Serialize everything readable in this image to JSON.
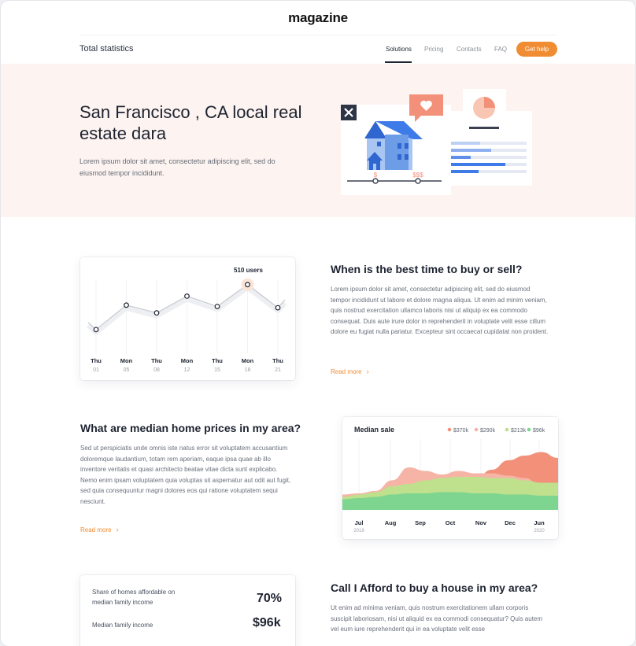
{
  "brand": "magazine",
  "nav": {
    "title": "Total statistics",
    "links": [
      "Solutions",
      "Pricing",
      "Contacts",
      "FAQ"
    ],
    "active": "Solutions",
    "cta": "Get help"
  },
  "hero": {
    "title": "San Francisco , CA local real estate dara",
    "subtitle": "Lorem ipsum dolor sit amet, consectetur adipiscing elit, sed do eiusmod tempor incididunt.",
    "illustration": {
      "price_low": "$",
      "price_high": "$$$"
    }
  },
  "section1": {
    "title": "When is the best time to buy or sell?",
    "body": "Lorem ipsum dolor sit amet, consectetur adipiscing elit, sed do eiusmod tempor incididunt ut labore et dolore magna aliqua. Ut enim ad minim veniam, quis nostrud exercitation ullamco laboris nisi ut aliquip ex ea commodo consequat. Duis aute irure dolor in reprehenderit in voluptate velit esse cillum dolore eu fugiat nulla pariatur. Excepteur sint occaecat cupidatat non proident.",
    "read_more": "Read more"
  },
  "section2": {
    "title": "What are median home prices in my area?",
    "body": "Sed ut perspiciatis unde omnis iste natus error sit voluptatem accusantium doloremque laudantium, totam rem aperiam, eaque ipsa quae ab illo inventore veritatis et quasi architecto beatae vitae dicta sunt explicabo. Nemo enim ipsam voluptatem quia voluptas sit aspernatur aut odit aut fugit, sed quia consequuntur magni dolores eos qui ratione voluptatem sequi nesciunt.",
    "read_more": "Read more"
  },
  "section3": {
    "title": "Call I Afford to buy a house in my area?",
    "body": "Ut enim ad minima veniam, quis nostrum exercitationem ullam corporis suscipit laboriosam, nisi ut aliquid ex ea commodi consequatur? Quis autem vel eum iure reprehenderit qui in ea voluptate velit esse",
    "stats": [
      {
        "label": "Share of homes affordable on median family income",
        "value": "70%"
      },
      {
        "label": "Median family income",
        "value": "$96k"
      }
    ]
  },
  "colors": {
    "accent": "#f08c32",
    "hero_bg": "#fdf3f0",
    "blue": "#3d7ce8",
    "salmon": "#f3907a",
    "lightgreen": "#bfe08d",
    "green": "#7ed58f"
  },
  "chart_data": [
    {
      "type": "line",
      "callout": "510 users",
      "x": [
        {
          "day": "Thu",
          "date": "01"
        },
        {
          "day": "Mon",
          "date": "05"
        },
        {
          "day": "Thu",
          "date": "08"
        },
        {
          "day": "Mon",
          "date": "12"
        },
        {
          "day": "Thu",
          "date": "15"
        },
        {
          "day": "Mon",
          "date": "18"
        },
        {
          "day": "Thu",
          "date": "21"
        }
      ],
      "values": [
        160,
        350,
        290,
        420,
        340,
        510,
        330
      ],
      "highlight_index": 5,
      "ylim": [
        0,
        600
      ]
    },
    {
      "type": "area",
      "title": "Median sale",
      "legend": [
        {
          "name": "$370k",
          "color": "#f3907a"
        },
        {
          "name": "$290k",
          "color": "#f6b4a6"
        },
        {
          "name": "$213k",
          "color": "#bfe08d"
        },
        {
          "name": "$96k",
          "color": "#7ed58f"
        }
      ],
      "categories": [
        "Jul",
        "Aug",
        "Sep",
        "Oct",
        "Nov",
        "Dec",
        "Jun"
      ],
      "years": [
        "2019",
        "2020"
      ],
      "series": [
        {
          "name": "$370k",
          "values": [
            13,
            13,
            16,
            25,
            35,
            27,
            27,
            30,
            26,
            34,
            42,
            46,
            49,
            44
          ]
        },
        {
          "name": "$290k",
          "values": [
            13,
            14,
            16,
            25,
            36,
            33,
            30,
            33,
            31,
            31,
            29,
            27,
            20,
            22
          ]
        },
        {
          "name": "$213k",
          "values": [
            11,
            13,
            15,
            20,
            22,
            25,
            27,
            28,
            28,
            27,
            27,
            25,
            23,
            23
          ]
        },
        {
          "name": "$96k",
          "values": [
            9,
            10,
            11,
            13,
            14,
            14,
            15,
            15,
            14,
            14,
            13,
            13,
            12,
            12
          ]
        }
      ],
      "ylim": [
        0,
        60
      ]
    }
  ]
}
